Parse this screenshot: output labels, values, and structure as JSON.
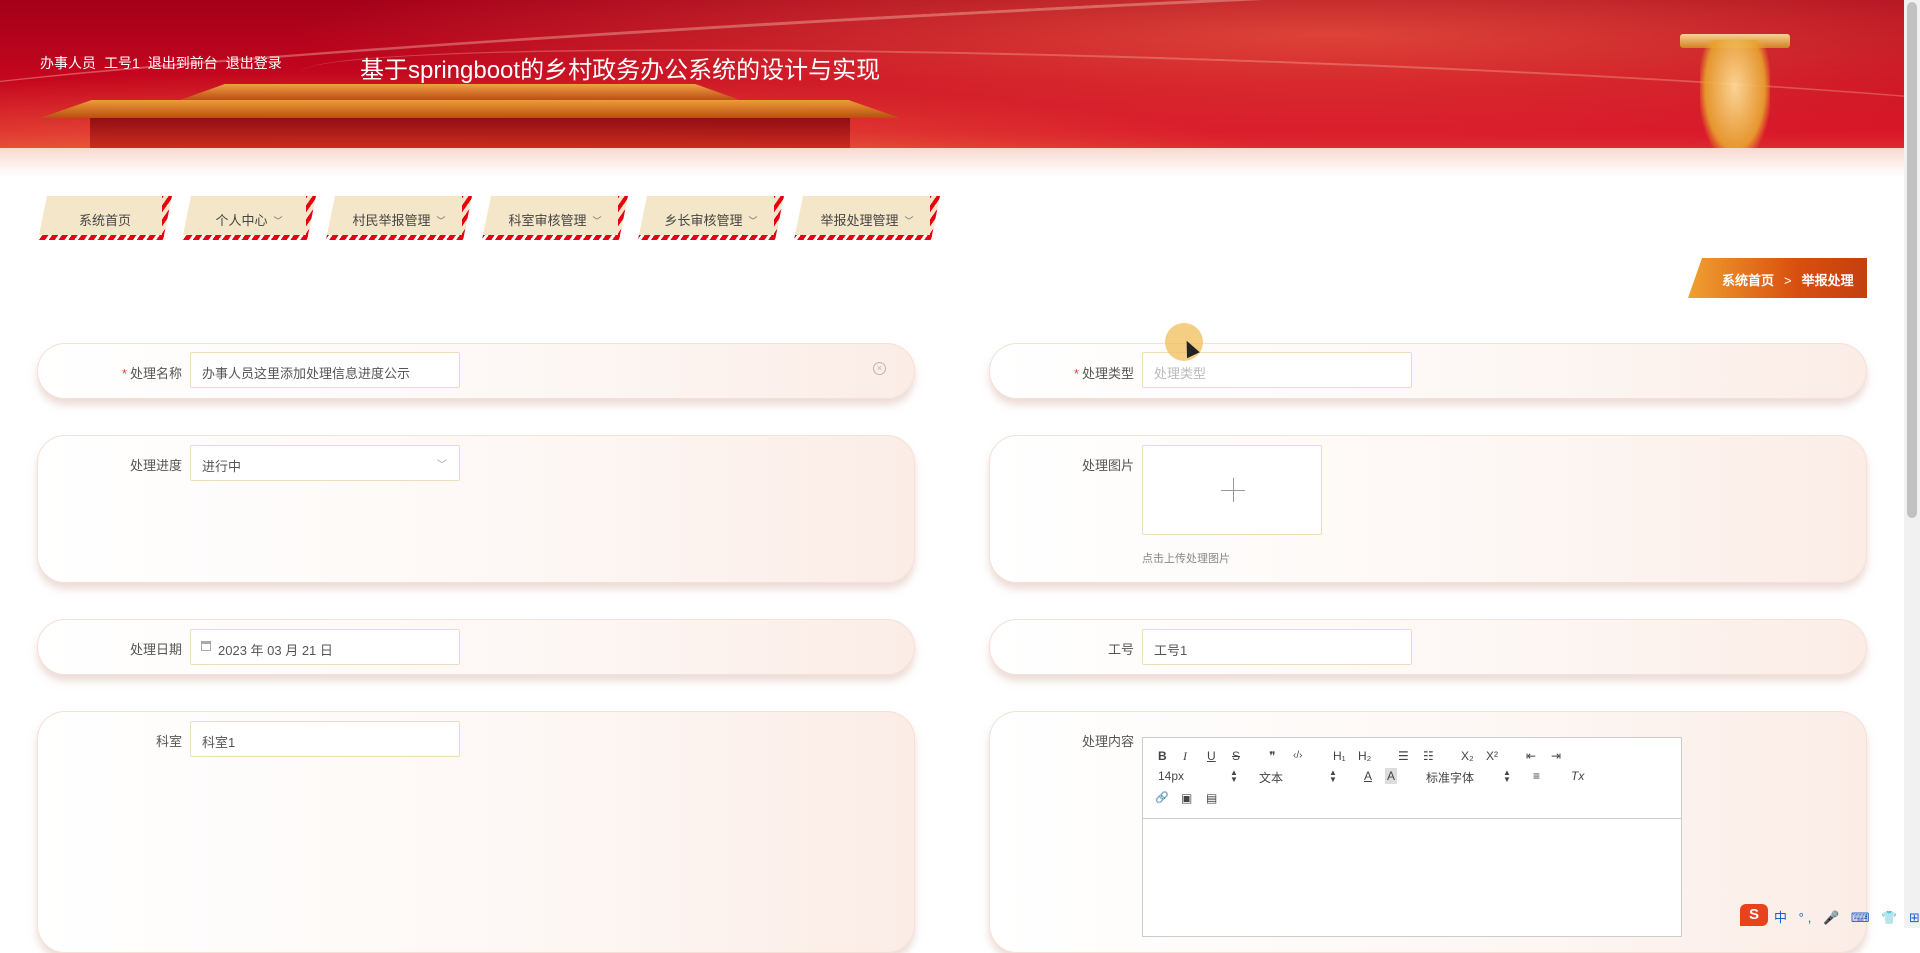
{
  "header": {
    "user_role": "办事人员",
    "user_name": "工号1",
    "to_frontend": "退出到前台",
    "logout": "退出登录",
    "site_title": "基于springboot的乡村政务办公系统的设计与实现"
  },
  "nav": {
    "items": [
      {
        "label": "系统首页",
        "dropdown": false
      },
      {
        "label": "个人中心",
        "dropdown": true
      },
      {
        "label": "村民举报管理",
        "dropdown": true
      },
      {
        "label": "科室审核管理",
        "dropdown": true
      },
      {
        "label": "乡长审核管理",
        "dropdown": true
      },
      {
        "label": "举报处理管理",
        "dropdown": true
      }
    ],
    "active_color": "#e60012",
    "tab_color": "#f4e6c8"
  },
  "breadcrumb": {
    "home": "系统首页",
    "separator": ">",
    "current": "举报处理"
  },
  "form": {
    "name": {
      "label": "处理名称",
      "required": true,
      "value": "办事人员这里添加处理信息进度公示"
    },
    "type": {
      "label": "处理类型",
      "required": true,
      "value": "",
      "placeholder": "处理类型"
    },
    "progress": {
      "label": "处理进度",
      "value": "进行中"
    },
    "image": {
      "label": "处理图片",
      "hint": "点击上传处理图片"
    },
    "date": {
      "label": "处理日期",
      "value": "2023 年 03 月 21 日"
    },
    "staff_no": {
      "label": "工号",
      "value": "工号1"
    },
    "department": {
      "label": "科室",
      "value": "科室1"
    },
    "content": {
      "label": "处理内容"
    }
  },
  "editor": {
    "font_size": "14px",
    "block_type": "文本",
    "font_family": "标准字体",
    "buttons": {
      "bold": "B",
      "italic": "I",
      "underline": "U",
      "strike": "S",
      "quote": "❞",
      "code": "‹/›",
      "h1": "H₁",
      "h2": "H₂",
      "ordered_list": "☰",
      "bullet_list": "☷",
      "sub": "X₂",
      "sup": "X²",
      "outdent": "⇤",
      "indent": "⇥",
      "color": "A",
      "background": "A",
      "align": "≡",
      "clean": "Tx",
      "link": "🔗",
      "image": "▣",
      "video": "▤"
    }
  },
  "ime": {
    "logo": "S",
    "items": "中 °, 🎤 ⌨ 👕 ⊞"
  }
}
